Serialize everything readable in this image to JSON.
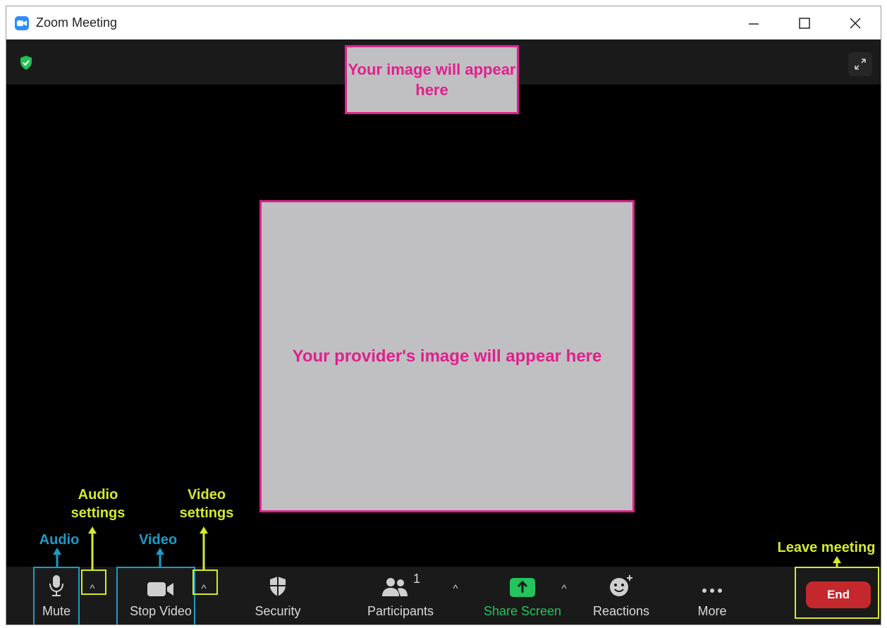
{
  "window": {
    "title": "Zoom Meeting"
  },
  "video_area": {
    "self_view_text": "Your image will appear here",
    "provider_view_text": "Your provider's image will appear here"
  },
  "toolbar": {
    "mute": "Mute",
    "stop_video": "Stop Video",
    "security": "Security",
    "participants": "Participants",
    "participants_count": "1",
    "share_screen": "Share Screen",
    "reactions": "Reactions",
    "more": "More",
    "end": "End"
  },
  "annotations": {
    "audio": "Audio",
    "audio_settings": "Audio settings",
    "video": "Video",
    "video_settings": "Video settings",
    "leave_meeting": "Leave meeting"
  },
  "colors": {
    "accent_zoom_blue": "#2d8cff",
    "share_screen_green": "#22c55e",
    "end_red": "#c4282d",
    "placeholder_magenta": "#e0208c",
    "annotation_yellow": "#d6e832",
    "annotation_blue": "#1e9bc7"
  },
  "icons": [
    "zoom-app-icon",
    "minimize-icon",
    "maximize-icon",
    "close-icon",
    "security-shield-icon",
    "fullscreen-icon",
    "microphone-icon",
    "video-camera-icon",
    "shield-icon",
    "participants-icon",
    "share-screen-icon",
    "reactions-icon",
    "more-icon"
  ]
}
